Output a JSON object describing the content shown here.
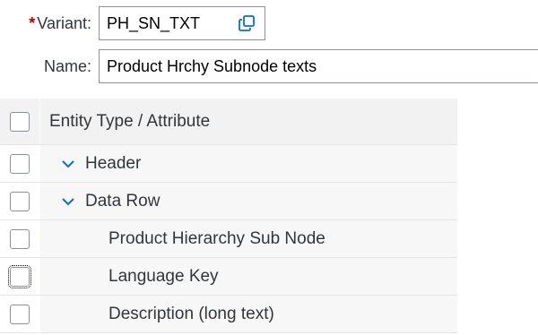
{
  "form": {
    "variant_label": "Variant:",
    "required_marker": "*",
    "variant_value": "PH_SN_TXT",
    "name_label": "Name:",
    "name_value": "Product Hrchy Subnode texts"
  },
  "table": {
    "header": "Entity Type / Attribute",
    "rows": [
      {
        "label": "Header",
        "level": 1,
        "expandable": true
      },
      {
        "label": "Data Row",
        "level": 1,
        "expandable": true
      },
      {
        "label": "Product Hierarchy Sub Node",
        "level": 2,
        "expandable": false
      },
      {
        "label": "Language Key",
        "level": 2,
        "expandable": false
      },
      {
        "label": "Description (long text)",
        "level": 2,
        "expandable": false
      }
    ]
  },
  "icons": {
    "value_help": "value-help-icon",
    "expand": "chevron-down-icon"
  },
  "colors": {
    "required": "#bb0000",
    "accent": "#0a6ed1"
  }
}
